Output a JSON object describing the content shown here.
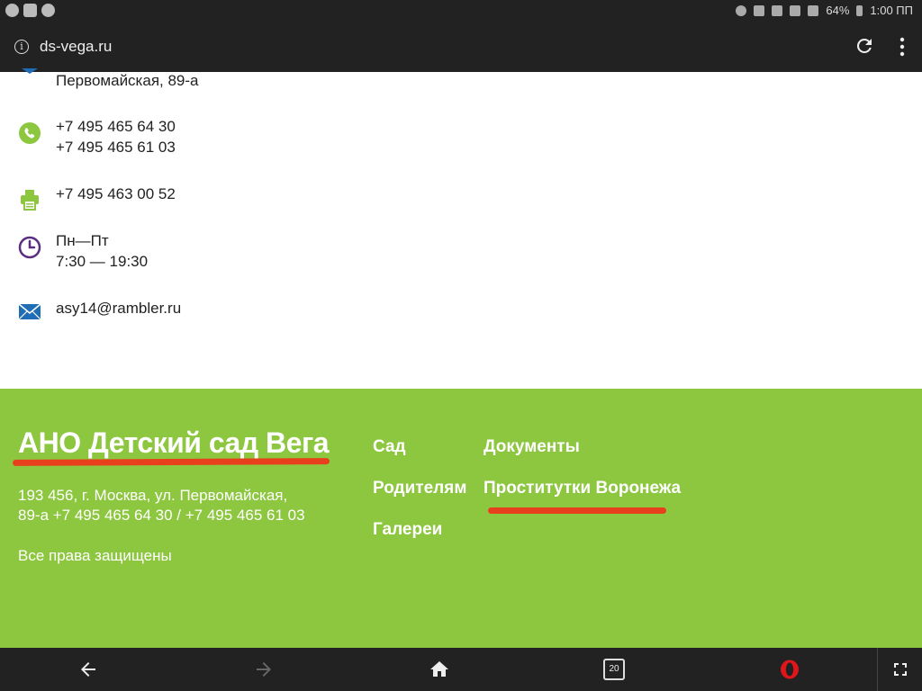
{
  "status_bar": {
    "battery": "64%",
    "time": "1:00 ПП"
  },
  "browser": {
    "url": "ds-vega.ru",
    "tab_count": "20"
  },
  "contacts": {
    "address_partial": "Первомайская, 89-а",
    "phone_1": "+7 495 465 64 30",
    "phone_2": "+7 495 465 61 03",
    "fax": "+7 495 463 00 52",
    "hours_days": "Пн—Пт",
    "hours_time": "7:30 — 19:30",
    "email": "asy14@rambler.ru"
  },
  "footer": {
    "title": "АНО Детский сад Вега",
    "address_line1": "193 456, г. Москва, ул. Первомайская,",
    "address_line2": "89-а +7 495 465 64 30 / +7 495 465 61 03",
    "rights": "Все права защищены",
    "nav": {
      "garden": "Сад",
      "parents": "Родителям",
      "galleries": "Галереи",
      "documents": "Документы",
      "ad_link": "Проститутки Воронежа"
    }
  },
  "colors": {
    "footer_bg": "#8dc63f",
    "chrome_bg": "#222222",
    "annotation_red": "#e8401c",
    "phone_icon": "#8dc63f",
    "clock_icon": "#5b2d82",
    "mail_icon": "#1f6db5"
  }
}
